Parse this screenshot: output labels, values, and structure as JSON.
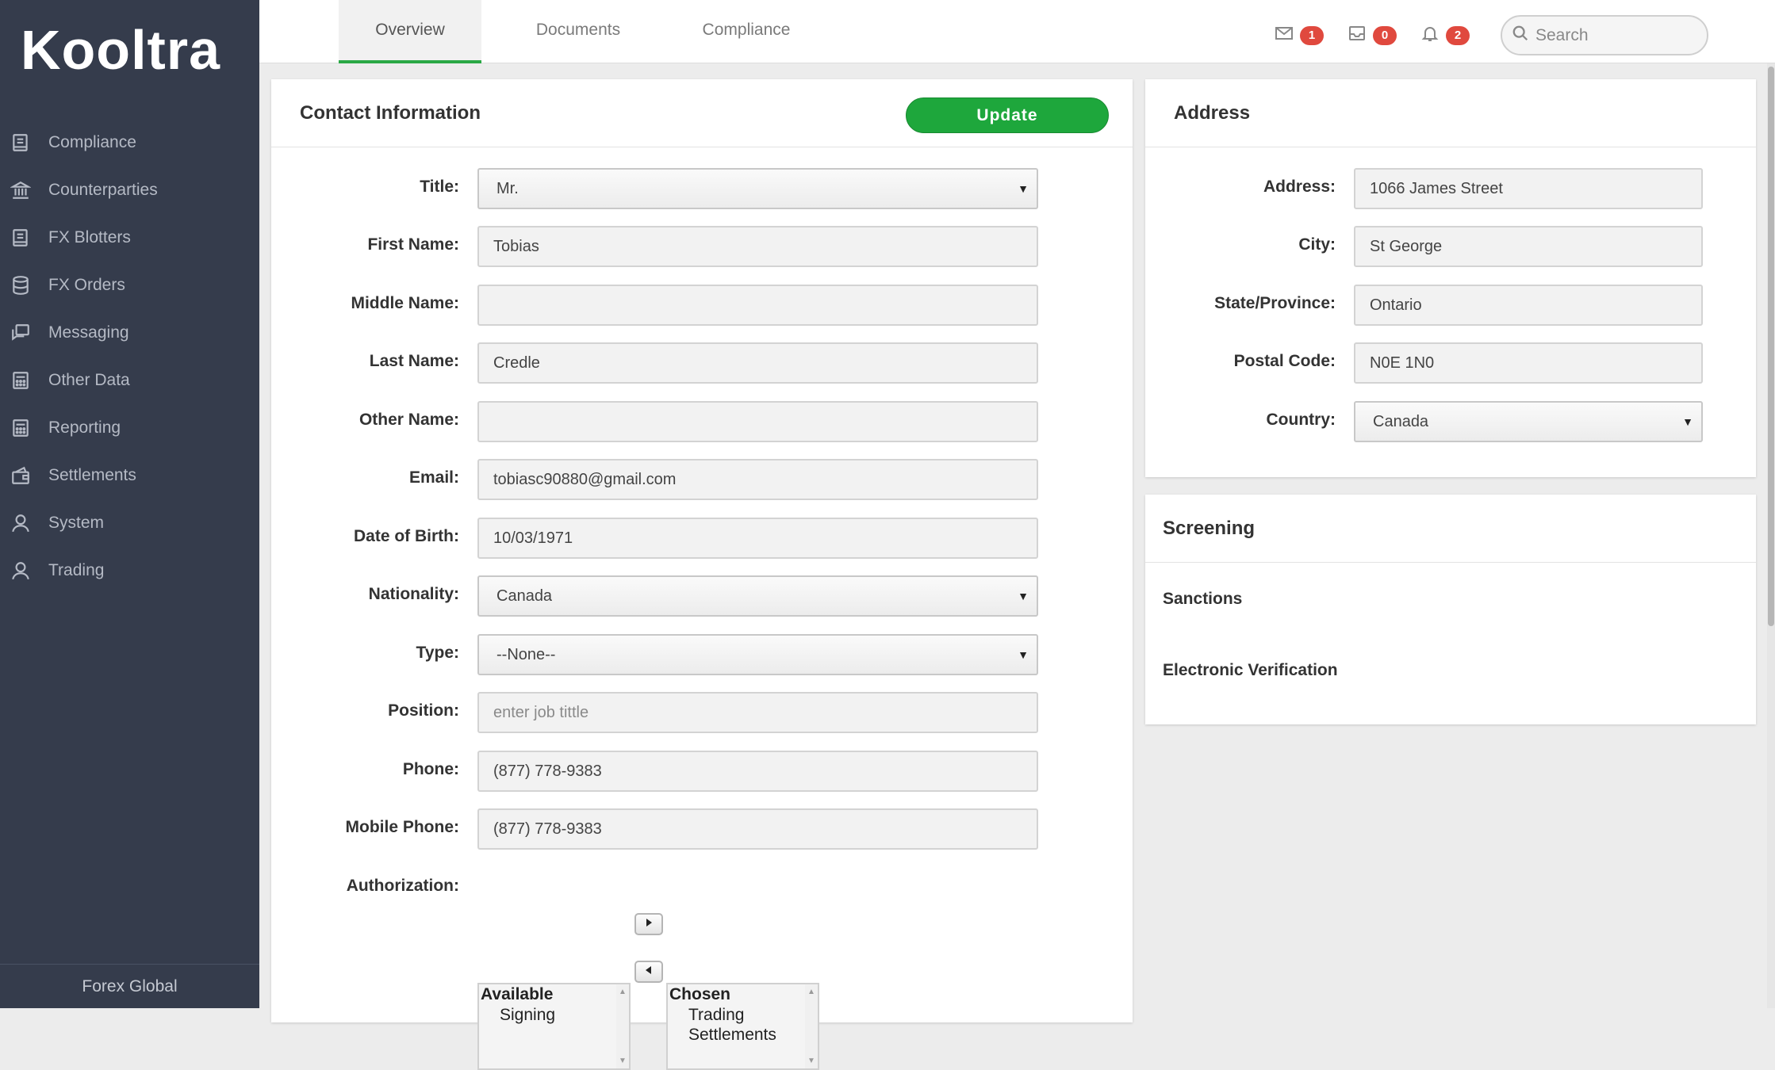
{
  "brand": {
    "logo": "Kooltra",
    "footer": "Forex Global"
  },
  "sidebar": {
    "items": [
      {
        "label": "Compliance",
        "icon": "book-icon"
      },
      {
        "label": "Counterparties",
        "icon": "bank-icon"
      },
      {
        "label": "FX Blotters",
        "icon": "book-icon"
      },
      {
        "label": "FX Orders",
        "icon": "database-icon"
      },
      {
        "label": "Messaging",
        "icon": "chat-icon"
      },
      {
        "label": "Other Data",
        "icon": "calculator-icon"
      },
      {
        "label": "Reporting",
        "icon": "calculator-icon"
      },
      {
        "label": "Settlements",
        "icon": "wallet-icon"
      },
      {
        "label": "System",
        "icon": "user-icon"
      },
      {
        "label": "Trading",
        "icon": "user-icon"
      }
    ]
  },
  "tabs": [
    {
      "label": "Overview",
      "active": true
    },
    {
      "label": "Documents",
      "active": false
    },
    {
      "label": "Compliance",
      "active": false
    }
  ],
  "header": {
    "mail_count": "1",
    "inbox_count": "0",
    "bell_count": "2",
    "search_placeholder": "Search"
  },
  "contact": {
    "title": "Contact Information",
    "update_label": "Update",
    "fields": {
      "title": {
        "label": "Title:",
        "value": "Mr."
      },
      "first_name": {
        "label": "First Name:",
        "value": "Tobias"
      },
      "middle_name": {
        "label": "Middle Name:",
        "value": ""
      },
      "last_name": {
        "label": "Last Name:",
        "value": "Credle"
      },
      "other_name": {
        "label": "Other Name:",
        "value": ""
      },
      "email": {
        "label": "Email:",
        "value": "tobiasc90880@gmail.com"
      },
      "dob": {
        "label": "Date of Birth:",
        "value": "10/03/1971"
      },
      "nationality": {
        "label": "Nationality:",
        "value": "Canada"
      },
      "type": {
        "label": "Type:",
        "value": "--None--"
      },
      "position": {
        "label": "Position:",
        "value": "",
        "placeholder": "enter job tittle"
      },
      "phone": {
        "label": "Phone:",
        "value": "(877) 778-9383"
      },
      "mobile": {
        "label": "Mobile Phone:",
        "value": "(877) 778-9383"
      },
      "authorization": {
        "label": "Authorization:"
      }
    },
    "authorization": {
      "available_header": "Available",
      "available": [
        "Signing"
      ],
      "chosen_header": "Chosen",
      "chosen": [
        "Trading",
        "Settlements"
      ]
    }
  },
  "address": {
    "title": "Address",
    "fields": {
      "address": {
        "label": "Address:",
        "value": "1066 James Street"
      },
      "city": {
        "label": "City:",
        "value": "St George"
      },
      "state": {
        "label": "State/Province:",
        "value": "Ontario"
      },
      "postal": {
        "label": "Postal Code:",
        "value": "N0E 1N0"
      },
      "country": {
        "label": "Country:",
        "value": "Canada"
      }
    }
  },
  "screening": {
    "title": "Screening",
    "items": [
      "Sanctions",
      "Electronic Verification"
    ]
  },
  "colors": {
    "sidebar_bg": "#353c4c",
    "accent_green": "#1ea73c",
    "badge_red": "#e0493e"
  }
}
